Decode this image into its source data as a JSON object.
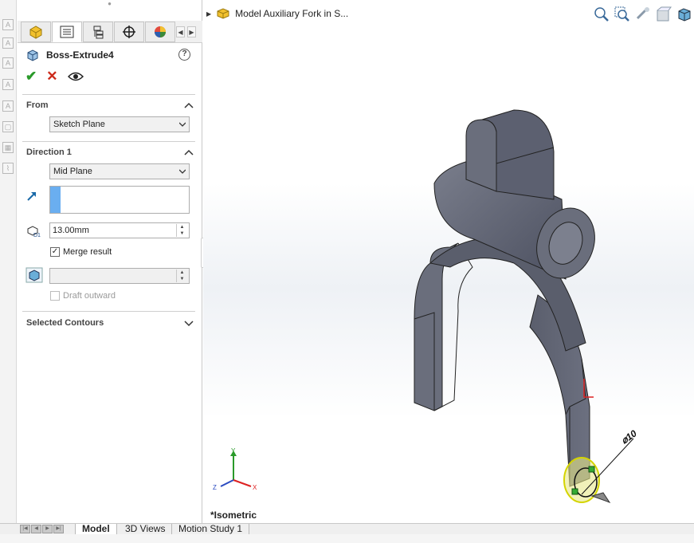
{
  "panel": {
    "feature_title": "Boss-Extrude4",
    "help_icon": "?",
    "from": {
      "title": "From",
      "value": "Sketch Plane"
    },
    "direction1": {
      "title": "Direction 1",
      "end_condition": "Mid Plane",
      "depth": "13.00mm",
      "merge_result_label": "Merge result",
      "merge_result_checked": true,
      "draft_outward_label": "Draft outward",
      "draft_outward_checked": false
    },
    "selected_contours": {
      "title": "Selected Contours"
    }
  },
  "viewport": {
    "part_name": "Model Auxiliary Fork in S...",
    "view_label": "*Isometric",
    "dimension_label": "⌀10",
    "triad": {
      "x": "X",
      "y": "Y",
      "z": "Z"
    }
  },
  "bottom_tabs": {
    "model": "Model",
    "views3d": "3D Views",
    "motion": "Motion Study 1"
  },
  "colors": {
    "model_body": "#5e6270",
    "accent_blue": "#6aaef0",
    "ok_green": "#2a9a2a",
    "cancel_red": "#cc2a1a"
  }
}
